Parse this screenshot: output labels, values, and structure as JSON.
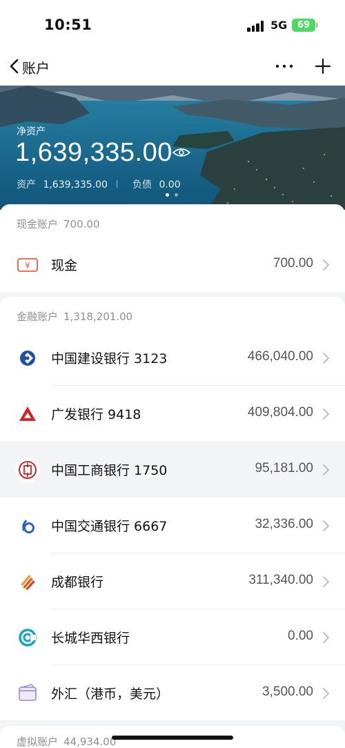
{
  "status": {
    "time": "10:51",
    "network": "5G",
    "battery": "69"
  },
  "nav": {
    "title": "账户"
  },
  "summary": {
    "net_label": "净资产",
    "net_value": "1,639,335.00",
    "assets_label": "资产",
    "assets_value": "1,639,335.00",
    "liabilities_label": "负债",
    "liabilities_value": "0.00"
  },
  "groups": [
    {
      "title": "现金账户",
      "total": "700.00",
      "items": [
        {
          "name": "现金",
          "amount": "700.00",
          "icon": "cash-yuan-icon"
        }
      ]
    },
    {
      "title": "金融账户",
      "total": "1,318,201.00",
      "items": [
        {
          "name": "中国建设银行 3123",
          "amount": "466,040.00",
          "icon": "ccb-logo-icon"
        },
        {
          "name": "广发银行 9418",
          "amount": "409,804.00",
          "icon": "cgb-logo-icon"
        },
        {
          "name": "中国工商银行 1750",
          "amount": "95,181.00",
          "icon": "icbc-logo-icon"
        },
        {
          "name": "中国交通银行 6667",
          "amount": "32,336.00",
          "icon": "bocom-logo-icon"
        },
        {
          "name": "成都银行",
          "amount": "311,340.00",
          "icon": "bocd-logo-icon"
        },
        {
          "name": "长城华西银行",
          "amount": "0.00",
          "icon": "gwhx-logo-icon"
        },
        {
          "name": "外汇（港币，美元）",
          "amount": "3,500.00",
          "icon": "forex-card-icon"
        }
      ]
    },
    {
      "title": "虚拟账户",
      "total": "44,934.00",
      "items": []
    }
  ],
  "colors": {
    "accent_green": "#4cd964",
    "ccb_blue": "#1e4fa3",
    "cgb_red": "#d0262a",
    "icbc_red": "#c1272d",
    "bocom_blue": "#2e63b8",
    "bocd_orange": "#d9622b",
    "gwhx_teal": "#11a4c2"
  }
}
